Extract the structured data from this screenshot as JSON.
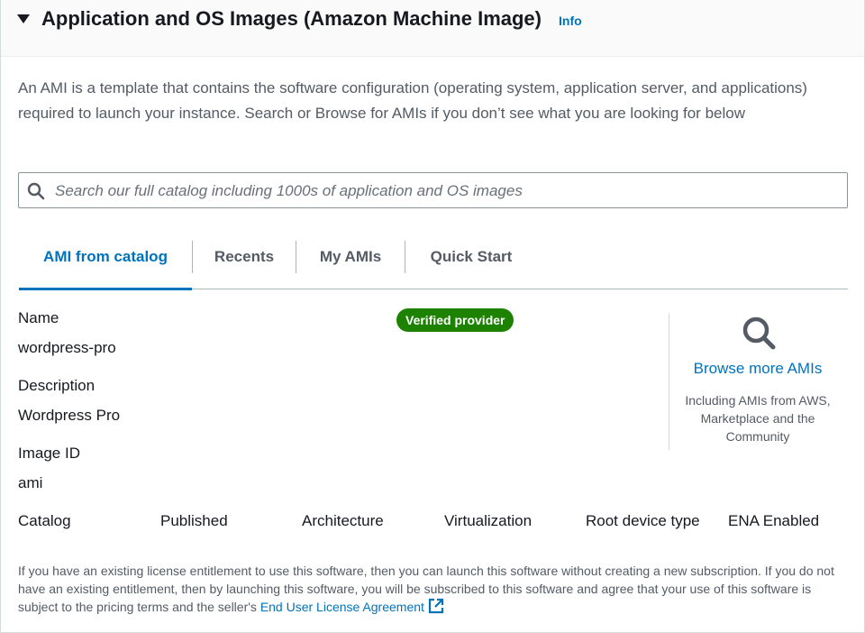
{
  "header": {
    "title": "Application and OS Images (Amazon Machine Image)",
    "info_label": "Info"
  },
  "description": "An AMI is a template that contains the software configuration (operating system, application server, and applications) required to launch your instance. Search or Browse for AMIs if you don’t see what you are looking for below",
  "search": {
    "placeholder": "Search our full catalog including 1000s of application and OS images",
    "value": ""
  },
  "tabs": [
    {
      "label": "AMI from catalog",
      "active": true
    },
    {
      "label": "Recents",
      "active": false
    },
    {
      "label": "My AMIs",
      "active": false
    },
    {
      "label": "Quick Start",
      "active": false
    }
  ],
  "ami": {
    "name_label": "Name",
    "name_value": "wordpress-pro",
    "description_label": "Description",
    "description_value": "Wordpress Pro",
    "image_id_label": "Image ID",
    "image_id_value": "ami",
    "badge": "Verified provider"
  },
  "browse": {
    "link_label": "Browse more AMIs",
    "subtext": "Including AMIs from AWS, Marketplace and the Community"
  },
  "meta_columns": [
    "Catalog",
    "Published",
    "Architecture",
    "Virtualization",
    "Root device type",
    "ENA Enabled"
  ],
  "license": {
    "text": "If you have an existing license entitlement to use this software, then you can launch this software without creating a new subscription. If you do not have an existing entitlement, then by launching this software, you will be subscribed to this software and agree that your use of this software is subject to the pricing terms and the seller's ",
    "link_label": "End User License Agreement"
  },
  "colors": {
    "accent": "#0073bb",
    "badge_bg": "#1d8102",
    "text": "#16191f",
    "muted": "#545b64"
  },
  "icons": {
    "caret": "caret-down-icon",
    "search": "search-icon",
    "browse": "magnifier-icon",
    "external": "external-link-icon"
  }
}
